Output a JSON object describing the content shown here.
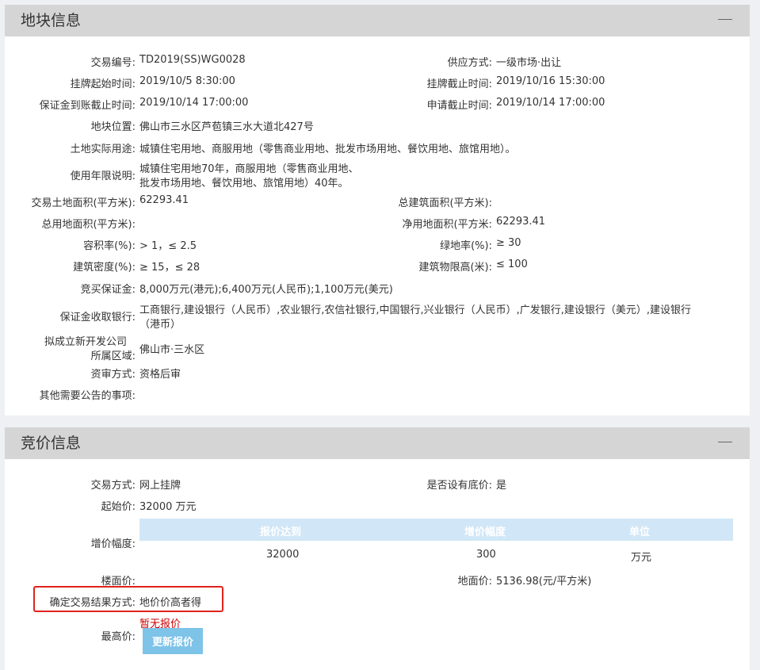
{
  "land_panel": {
    "title": "地块信息",
    "rows": [
      {
        "label": "交易编号:",
        "value": "TD2019(SS)WG0028",
        "label2": "供应方式:",
        "value2": "一级市场·出让"
      },
      {
        "label": "挂牌起始时间:",
        "value": "2019/10/5 8:30:00",
        "label2": "挂牌截止时间:",
        "value2": "2019/10/16 15:30:00"
      },
      {
        "label": "保证金到账截止时间:",
        "value": "2019/10/14 17:00:00",
        "label2": "申请截止时间:",
        "value2": "2019/10/14 17:00:00"
      }
    ],
    "location_label": "地块位置:",
    "location_value": "佛山市三水区芦苞镇三水大道北427号",
    "usage_label": "土地实际用途:",
    "usage_value": "城镇住宅用地、商服用地（零售商业用地、批发市场用地、餐饮用地、旅馆用地）。",
    "term_label": "使用年限说明:",
    "term_value_1": "城镇住宅用地70年，商服用地（零售商业用地、",
    "term_value_2": "批发市场用地、餐饮用地、旅馆用地）40年。",
    "area_label": "交易土地面积(平方米):",
    "area_value": "62293.41",
    "total_build_label": "总建筑面积(平方米):",
    "total_build_value": "",
    "total_use_label": "总用地面积(平方米):",
    "total_use_value": "",
    "net_label": "净用地面积(平方米:",
    "net_value": "62293.41",
    "far_label": "容积率(%):",
    "far_value": "> 1，≤ 2.5",
    "green_label": "绿地率(%):",
    "green_value": "≥ 30",
    "density_label": "建筑密度(%):",
    "density_value": "≥ 15，≤ 28",
    "height_label": "建筑物限高(米):",
    "height_value": "≤ 100",
    "deposit_label": "竞买保证金:",
    "deposit_value": "8,000万元(港元);6,400万元(人民币);1,100万元(美元)",
    "bank_label": "保证金收取银行:",
    "bank_value_1": "工商银行,建设银行（人民币）,农业银行,农信社银行,中国银行,兴业银行（人民币）,广发银行,建设银行（美元）,建设银行",
    "bank_value_2": "（港币）",
    "company_label_1": "拟成立新开发公司",
    "company_label_2": "所属区域:",
    "company_value": "佛山市·三水区",
    "review_label": "资审方式:",
    "review_value": "资格后审",
    "other_label": "其他需要公告的事项:",
    "other_value": ""
  },
  "bid_panel": {
    "title": "竞价信息",
    "method_label": "交易方式:",
    "method_value": "网上挂牌",
    "floor_label": "是否设有底价:",
    "floor_value": "是",
    "start_label": "起始价:",
    "start_value": "32000 万元",
    "inc_label": "增价幅度:",
    "inc_headers": [
      "报价达到",
      "增价幅度",
      "单位"
    ],
    "inc_row": [
      "32000",
      "300",
      "万元"
    ],
    "floor_price_label": "楼面价:",
    "floor_price_value": "",
    "land_price_label": "地面价:",
    "land_price_value": "5136.98(元/平方米)",
    "result_label": "确定交易结果方式:",
    "result_value": "地价价高者得",
    "no_bid": "暂无报价",
    "highest_label": "最高价:",
    "refresh_button": "更新报价"
  }
}
